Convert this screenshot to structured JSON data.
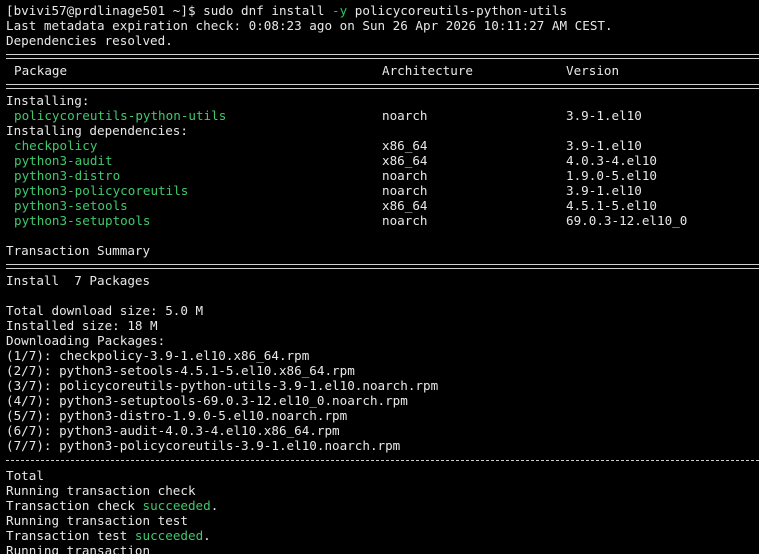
{
  "prompt": "[bvivi57@prdlinage501 ~]$ ",
  "command": {
    "pre": "sudo dnf install ",
    "flag": "-y",
    "post": " policycoreutils-python-utils"
  },
  "meta_line": "Last metadata expiration check: 0:08:23 ago on Sun 26 Apr 2026 10:11:27 AM CEST.",
  "deps_resolved": "Dependencies resolved.",
  "table": {
    "headers": {
      "package": "Package",
      "arch": "Architecture",
      "version": "Version"
    },
    "installing_label": "Installing:",
    "installing": [
      {
        "name": "policycoreutils-python-utils",
        "arch": "noarch",
        "version": "3.9-1.el10"
      }
    ],
    "deps_label": "Installing dependencies:",
    "deps": [
      {
        "name": "checkpolicy",
        "arch": "x86_64",
        "version": "3.9-1.el10"
      },
      {
        "name": "python3-audit",
        "arch": "x86_64",
        "version": "4.0.3-4.el10"
      },
      {
        "name": "python3-distro",
        "arch": "noarch",
        "version": "1.9.0-5.el10"
      },
      {
        "name": "python3-policycoreutils",
        "arch": "noarch",
        "version": "3.9-1.el10"
      },
      {
        "name": "python3-setools",
        "arch": "x86_64",
        "version": "4.5.1-5.el10"
      },
      {
        "name": "python3-setuptools",
        "arch": "noarch",
        "version": "69.0.3-12.el10_0"
      }
    ]
  },
  "summary": {
    "title": "Transaction Summary",
    "install_line": "Install  7 Packages",
    "download_size": "Total download size: 5.0 M",
    "installed_size": "Installed size: 18 M",
    "downloading": "Downloading Packages:",
    "downloads": [
      "(1/7): checkpolicy-3.9-1.el10.x86_64.rpm",
      "(2/7): python3-setools-4.5.1-5.el10.x86_64.rpm",
      "(3/7): policycoreutils-python-utils-3.9-1.el10.noarch.rpm",
      "(4/7): python3-setuptools-69.0.3-12.el10_0.noarch.rpm",
      "(5/7): python3-distro-1.9.0-5.el10.noarch.rpm",
      "(6/7): python3-audit-4.0.3-4.el10.x86_64.rpm",
      "(7/7): python3-policycoreutils-3.9-1.el10.noarch.rpm"
    ]
  },
  "tail": {
    "total": "Total",
    "running_check": "Running transaction check",
    "check_pre": "Transaction check ",
    "check_ok": "succeeded",
    "check_post": ".",
    "running_test": "Running transaction test",
    "test_pre": "Transaction test ",
    "test_ok": "succeeded",
    "test_post": ".",
    "running": "Running transaction"
  },
  "colors": {
    "background": "#000000",
    "text": "#e8e8e8",
    "highlight": "#3ec96b"
  }
}
